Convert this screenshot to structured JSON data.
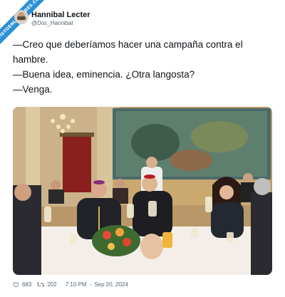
{
  "ribbon": {
    "text": "VISTOENLASREDES.COM"
  },
  "author": {
    "name": "Hannibal Lecter",
    "handle": "@Doc_Hannibal"
  },
  "tweet": {
    "lines": [
      "—Creo que deberíamos hacer una campaña contra el hambre.",
      "—Buena idea, eminencia. ¿Otra langosta?",
      "—Venga."
    ]
  },
  "stats": {
    "likes": "683",
    "retweets": "202",
    "time": "7:10 PM",
    "date": "Sep 20, 2024"
  },
  "icons": {
    "like": "heart-icon",
    "retweet": "retweet-icon"
  },
  "colors": {
    "ribbon": "#2a8fd6",
    "text": "#0f1419",
    "muted": "#536471"
  }
}
